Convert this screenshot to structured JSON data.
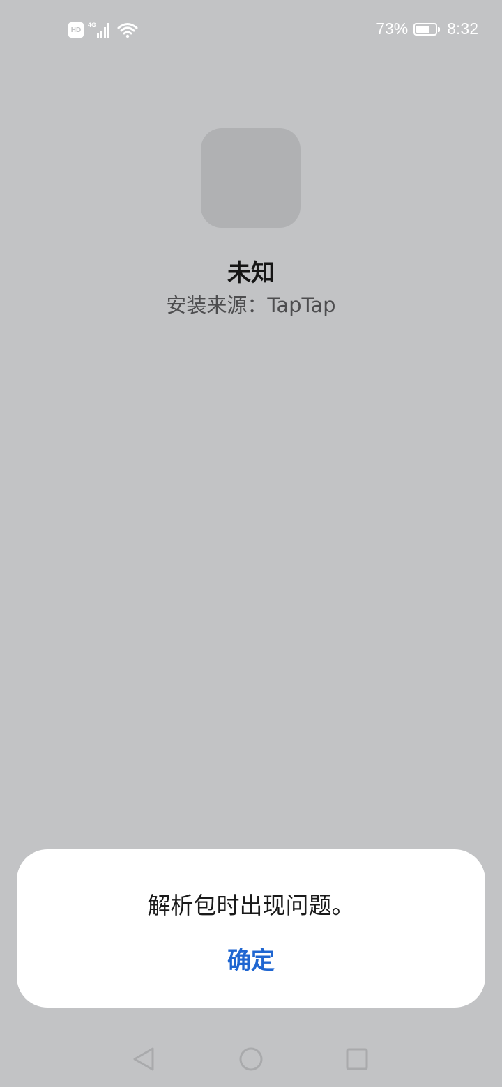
{
  "status_bar": {
    "hd_label": "HD",
    "network_label": "4G",
    "battery_percent": "73%",
    "battery_level": 0.73,
    "time": "8:32",
    "icons": [
      "hd-icon",
      "signal-icon",
      "wifi-icon",
      "battery-icon"
    ]
  },
  "app": {
    "name": "未知",
    "source": "安装来源：TapTap",
    "icon": "app-placeholder-icon"
  },
  "dialog": {
    "message": "解析包时出现问题。",
    "confirm_label": "确定",
    "confirm_color": "#1f66d1"
  },
  "nav_bar": {
    "icons": [
      "back-icon",
      "home-icon",
      "recents-icon"
    ]
  },
  "colors": {
    "background": "#c2c3c5",
    "dialog_bg": "#ffffff",
    "accent": "#1f66d1"
  }
}
